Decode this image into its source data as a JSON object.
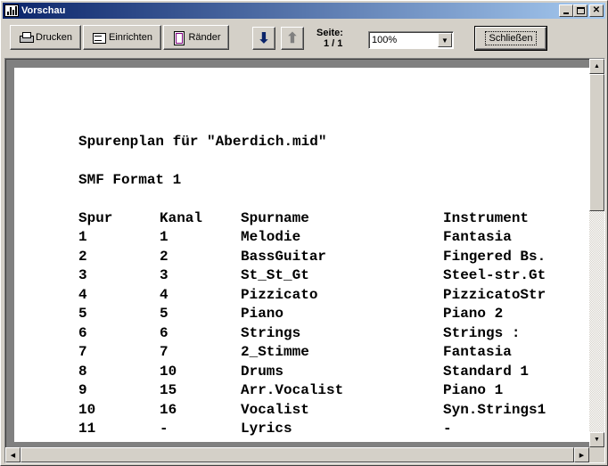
{
  "window": {
    "title": "Vorschau",
    "controls": [
      "minimize",
      "maximize",
      "close"
    ]
  },
  "toolbar": {
    "print_label": "Drucken",
    "setup_label": "Einrichten",
    "margins_label": "Ränder",
    "page_label": "Seite:",
    "page_value": "1 / 1",
    "zoom_value": "100%",
    "close_label": "Schließen"
  },
  "document": {
    "title_line": "Spurenplan für \"Aberdich.mid\"",
    "format_line": "SMF Format 1",
    "headers": [
      "Spur",
      "Kanal",
      "Spurname",
      "Instrument"
    ],
    "rows": [
      [
        "1",
        "1",
        "Melodie",
        "Fantasia"
      ],
      [
        "2",
        "2",
        "BassGuitar",
        "Fingered Bs."
      ],
      [
        "3",
        "3",
        "St_St_Gt",
        "Steel-str.Gt"
      ],
      [
        "4",
        "4",
        "Pizzicato",
        "PizzicatoStr"
      ],
      [
        "5",
        "5",
        "Piano",
        "Piano 2"
      ],
      [
        "6",
        "6",
        "Strings",
        "Strings :"
      ],
      [
        "7",
        "7",
        "2_Stimme",
        "Fantasia"
      ],
      [
        "8",
        "10",
        "Drums",
        "Standard 1"
      ],
      [
        "9",
        "15",
        "Arr.Vocalist",
        "Piano 1"
      ],
      [
        "10",
        "16",
        "Vocalist",
        "Syn.Strings1"
      ],
      [
        "11",
        "-",
        "Lyrics",
        "-"
      ]
    ]
  },
  "colors": {
    "titlebar_start": "#0a246a",
    "titlebar_end": "#a6caf0",
    "face": "#d4d0c8",
    "workspace": "#808080"
  }
}
